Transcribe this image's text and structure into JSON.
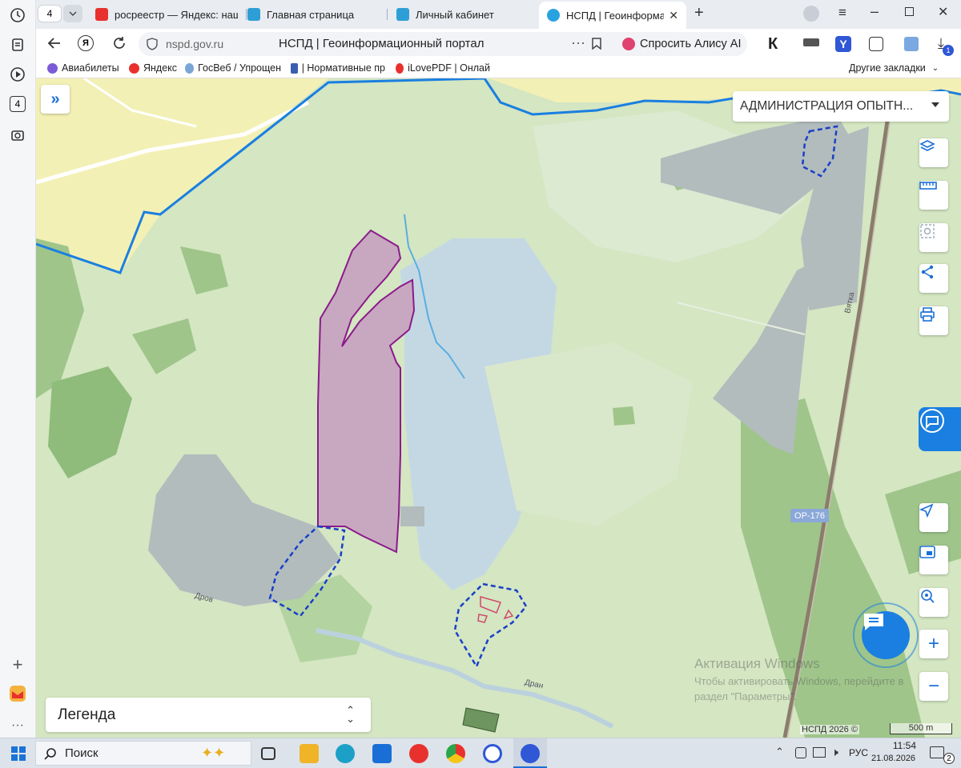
{
  "browser": {
    "tab_count": "4",
    "tabs": [
      {
        "label": "росреестр — Яндекс: наш"
      },
      {
        "label": "Главная страница"
      },
      {
        "label": "Личный кабинет"
      },
      {
        "label": "НСПД | Геоинформаци"
      }
    ],
    "url": "nspd.gov.ru",
    "page_title": "НСПД | Геоинформационный портал",
    "alice_label": "Спросить Алису AI",
    "download_badge": "1",
    "bookmarks": [
      {
        "label": "Авиабилеты",
        "color": "#7b5cd6"
      },
      {
        "label": "Яндекс",
        "color": "#e8312d"
      },
      {
        "label": "ГосВеб / Упрощен",
        "color": "#7aa6d6"
      },
      {
        "label": "| Нормативные пр",
        "color": "#3b5fb0"
      },
      {
        "label": "iLovePDF | Онлай",
        "color": "#e8312d"
      }
    ],
    "other_bookmarks": "Другие закладки",
    "sidebar_badge": "4"
  },
  "map": {
    "layer_dropdown": "АДМИНИСТРАЦИЯ ОПЫТН...",
    "legend_label": "Легенда",
    "road_label": "ОР-176",
    "rail_label": "Вятка",
    "river_label_1": "Дров",
    "river_label_2": "Дран",
    "copyright": "НСПД 2026 ©",
    "scale": "500 m",
    "activation_title": "Активация Windows",
    "activation_text_1": "Чтобы активировать Windows, перейдите в",
    "activation_text_2": "раздел \"Параметры\".",
    "colors": {
      "boundary": "#1a7fe0",
      "parcel_fill": "#c8a8c0",
      "parcel_stroke": "#8b1a8b",
      "zone_dash": "#1a3fc8",
      "water": "#c4d8e4",
      "field": "#d4e6c2",
      "forest": "#9fc58a",
      "yellow_area": "#f3f0b5",
      "gray_zone": "#b2bcbd"
    }
  },
  "taskbar": {
    "search_label": "Поиск",
    "language": "РУС",
    "time": "11:54",
    "date": "21.08.2026",
    "notifications": "2"
  }
}
